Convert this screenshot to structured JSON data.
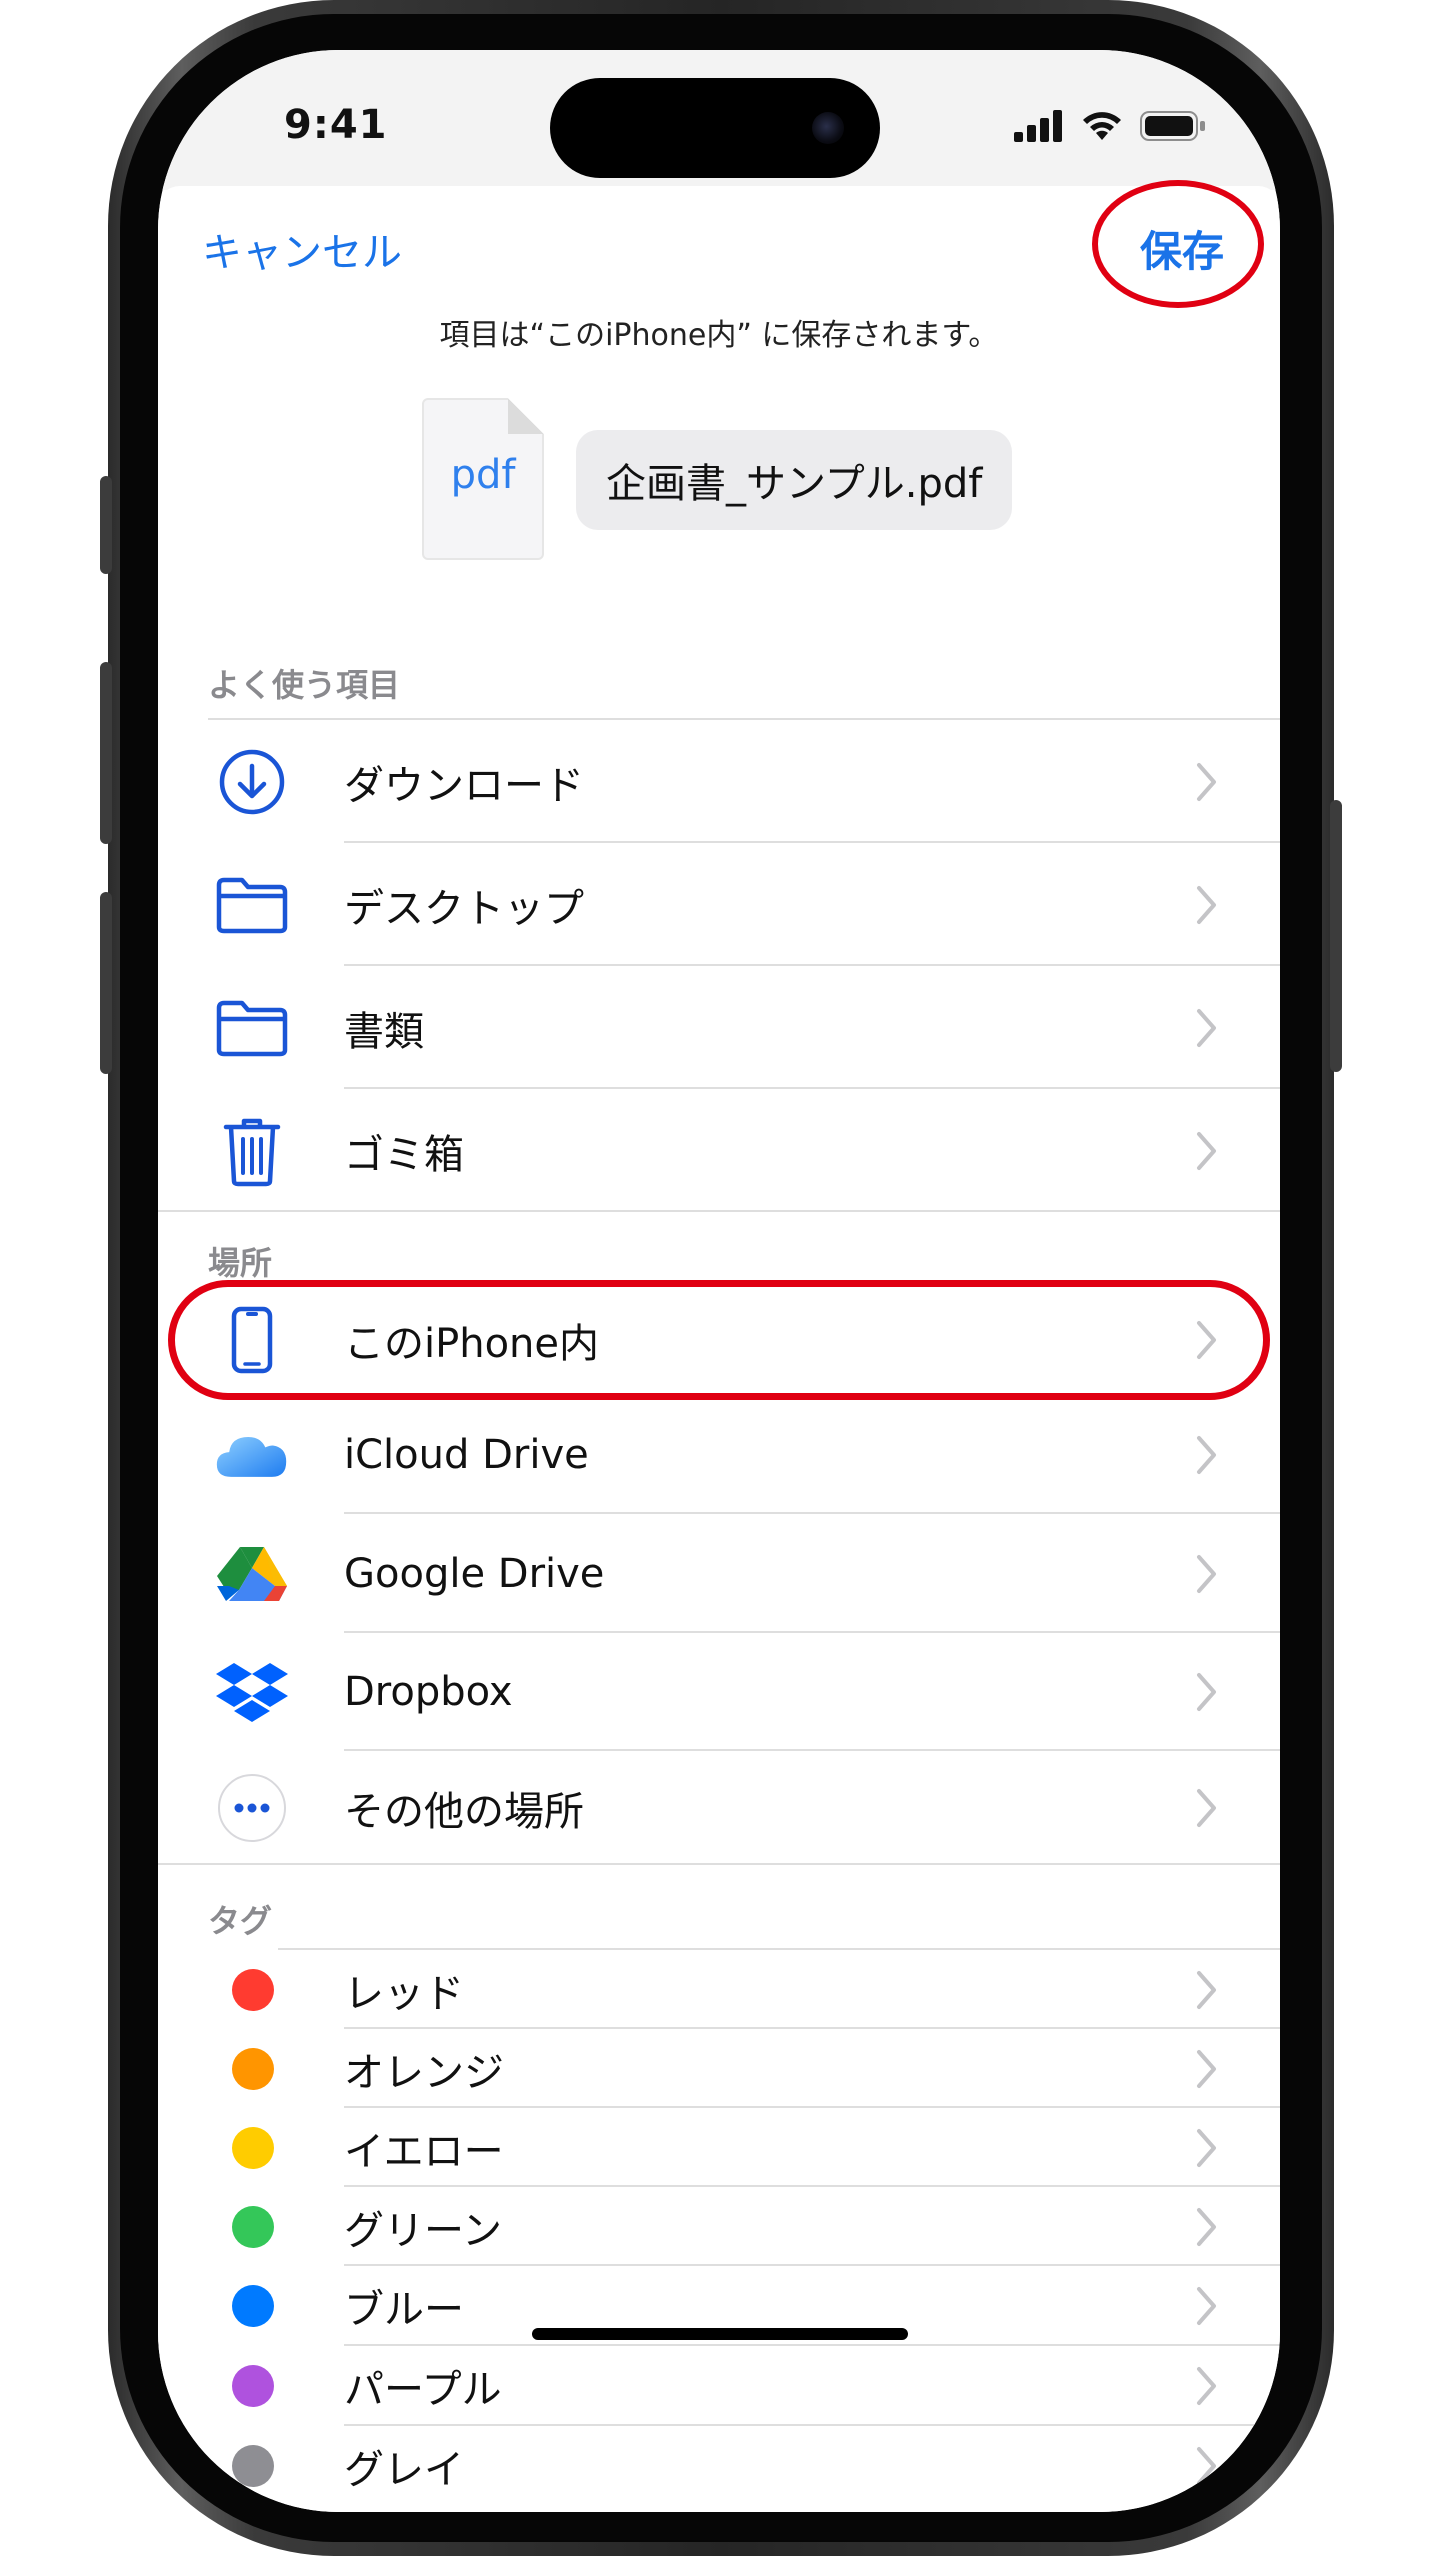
{
  "status": {
    "time": "9:41"
  },
  "header": {
    "cancel_label": "キャンセル",
    "save_label": "保存",
    "note": "項目は“このiPhone内” に保存されます。"
  },
  "file": {
    "type_label": "pdf",
    "name": "企画書_サンプル.pdf"
  },
  "favorites": {
    "heading": "よく使う項目",
    "items": [
      {
        "label": "ダウンロード",
        "icon": "download-icon"
      },
      {
        "label": "デスクトップ",
        "icon": "folder-icon"
      },
      {
        "label": "書類",
        "icon": "folder-icon"
      },
      {
        "label": "ゴミ箱",
        "icon": "trash-icon"
      }
    ]
  },
  "locations": {
    "heading": "場所",
    "items": [
      {
        "label": "このiPhone内",
        "icon": "iphone-icon"
      },
      {
        "label": "iCloud Drive",
        "icon": "icloud-icon"
      },
      {
        "label": "Google Drive",
        "icon": "google-drive-icon"
      },
      {
        "label": "Dropbox",
        "icon": "dropbox-icon"
      },
      {
        "label": "その他の場所",
        "icon": "more-icon"
      }
    ]
  },
  "tags": {
    "heading": "タグ",
    "items": [
      {
        "label": "レッド",
        "color": "#ff3b30"
      },
      {
        "label": "オレンジ",
        "color": "#ff9500"
      },
      {
        "label": "イエロー",
        "color": "#ffcc00"
      },
      {
        "label": "グリーン",
        "color": "#34c759"
      },
      {
        "label": "ブルー",
        "color": "#007aff"
      },
      {
        "label": "パープル",
        "color": "#af52de"
      },
      {
        "label": "グレイ",
        "color": "#8e8e93"
      }
    ]
  },
  "colors": {
    "accent": "#1a73e8",
    "highlight": "#e00012"
  }
}
